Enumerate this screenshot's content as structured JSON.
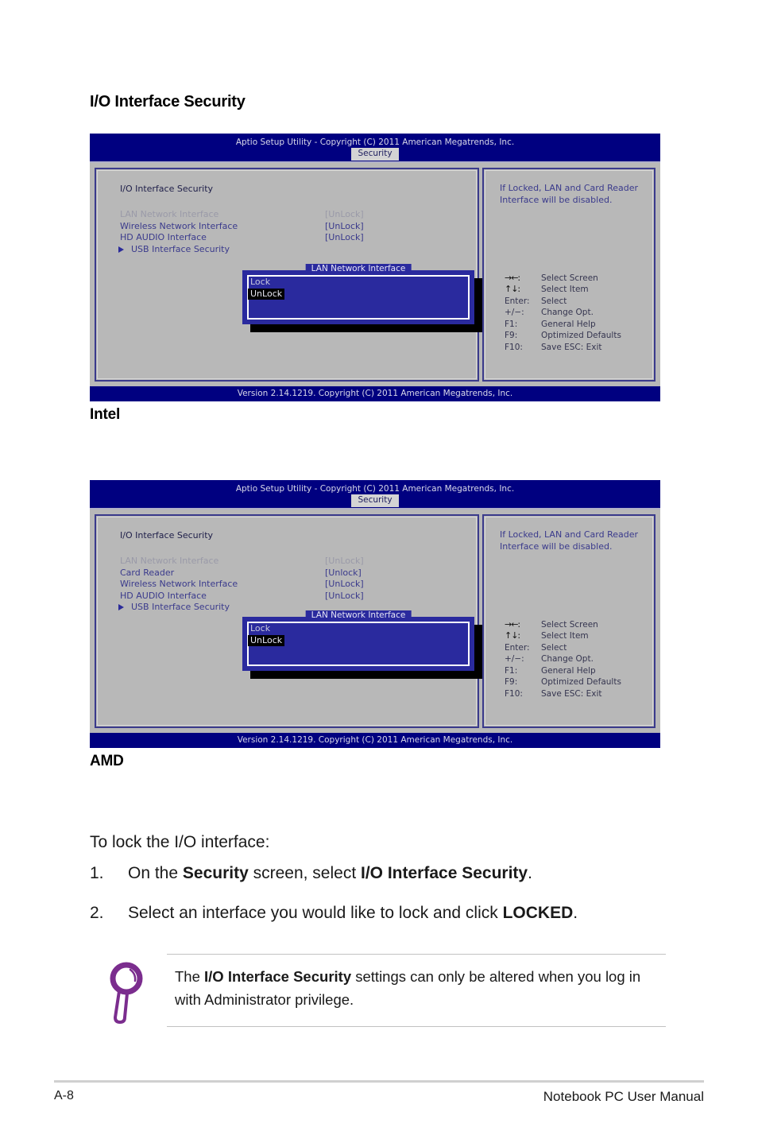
{
  "page": {
    "heading": "I/O Interface Security",
    "footer_page_number": "A-8",
    "footer_title": "Notebook PC User Manual"
  },
  "bios_common": {
    "title": "Aptio Setup Utility - Copyright (C) 2011 American Megatrends, Inc.",
    "tab": "Security",
    "section_title": "I/O Interface Security",
    "help_text": "If Locked, LAN and Card Reader Interface will be disabled.",
    "version": "Version 2.14.1219. Copyright (C) 2011 American Megatrends, Inc.",
    "legend": [
      {
        "key": "→←",
        "desc": "Select Screen",
        "is_arrow": true
      },
      {
        "key": "↑↓",
        "desc": "Select Item",
        "is_arrow": true
      },
      {
        "key": "Enter:",
        "desc": "Select",
        "is_arrow": false
      },
      {
        "key": "+/−:",
        "desc": "Change Opt.",
        "is_arrow": false
      },
      {
        "key": "F1:",
        "desc": "General Help",
        "is_arrow": false
      },
      {
        "key": "F9:",
        "desc": "Optimized Defaults",
        "is_arrow": false
      },
      {
        "key": "F10:",
        "desc": "Save    ESC:  Exit",
        "is_arrow": false
      }
    ],
    "dialog": {
      "title": "LAN Network Interface",
      "option_unselected": "Lock",
      "option_selected": "UnLock"
    }
  },
  "screen_intel": {
    "caption": "Intel",
    "rows": [
      {
        "label": "LAN Network Interface",
        "value": "[UnLock]",
        "dim": true
      },
      {
        "label": "Wireless Network Interface",
        "value": "[UnLock]",
        "dim": false
      },
      {
        "label": "HD AUDIO Interface",
        "value": "[UnLock]",
        "dim": false
      }
    ],
    "submenu": "USB Interface Security"
  },
  "screen_amd": {
    "caption": "AMD",
    "rows": [
      {
        "label": "LAN Network Interface",
        "value": "[UnLock]",
        "dim": true
      },
      {
        "label": "Card Reader",
        "value": "[Unlock]",
        "dim": false
      },
      {
        "label": "Wireless Network Interface",
        "value": "[UnLock]",
        "dim": false
      },
      {
        "label": "HD AUDIO Interface",
        "value": "[UnLock]",
        "dim": false
      }
    ],
    "submenu": "USB Interface Security"
  },
  "instructions": {
    "lead": "To lock the I/O interface:",
    "steps": [
      {
        "num": "1.",
        "pre": "On the ",
        "bold1": "Security",
        "mid": " screen, select ",
        "bold2": "I/O Interface Security",
        "post": "."
      },
      {
        "num": "2.",
        "pre": "Select an interface you would like to lock and click ",
        "bold1": "LOCKED",
        "mid": "",
        "bold2": "",
        "post": "."
      }
    ]
  },
  "note": {
    "icon": "magnifier-icon",
    "pre": "The ",
    "bold": "I/O Interface Security",
    "post": " settings can only be altered when you log in with Administrator privilege."
  },
  "colors": {
    "bios_titlebar": "#000080",
    "bios_background": "#b8b8b8",
    "bios_text_blue": "#3a3a8c",
    "dialog_blue": "#2a2a9e",
    "note_icon_purple": "#7b2d8e"
  }
}
